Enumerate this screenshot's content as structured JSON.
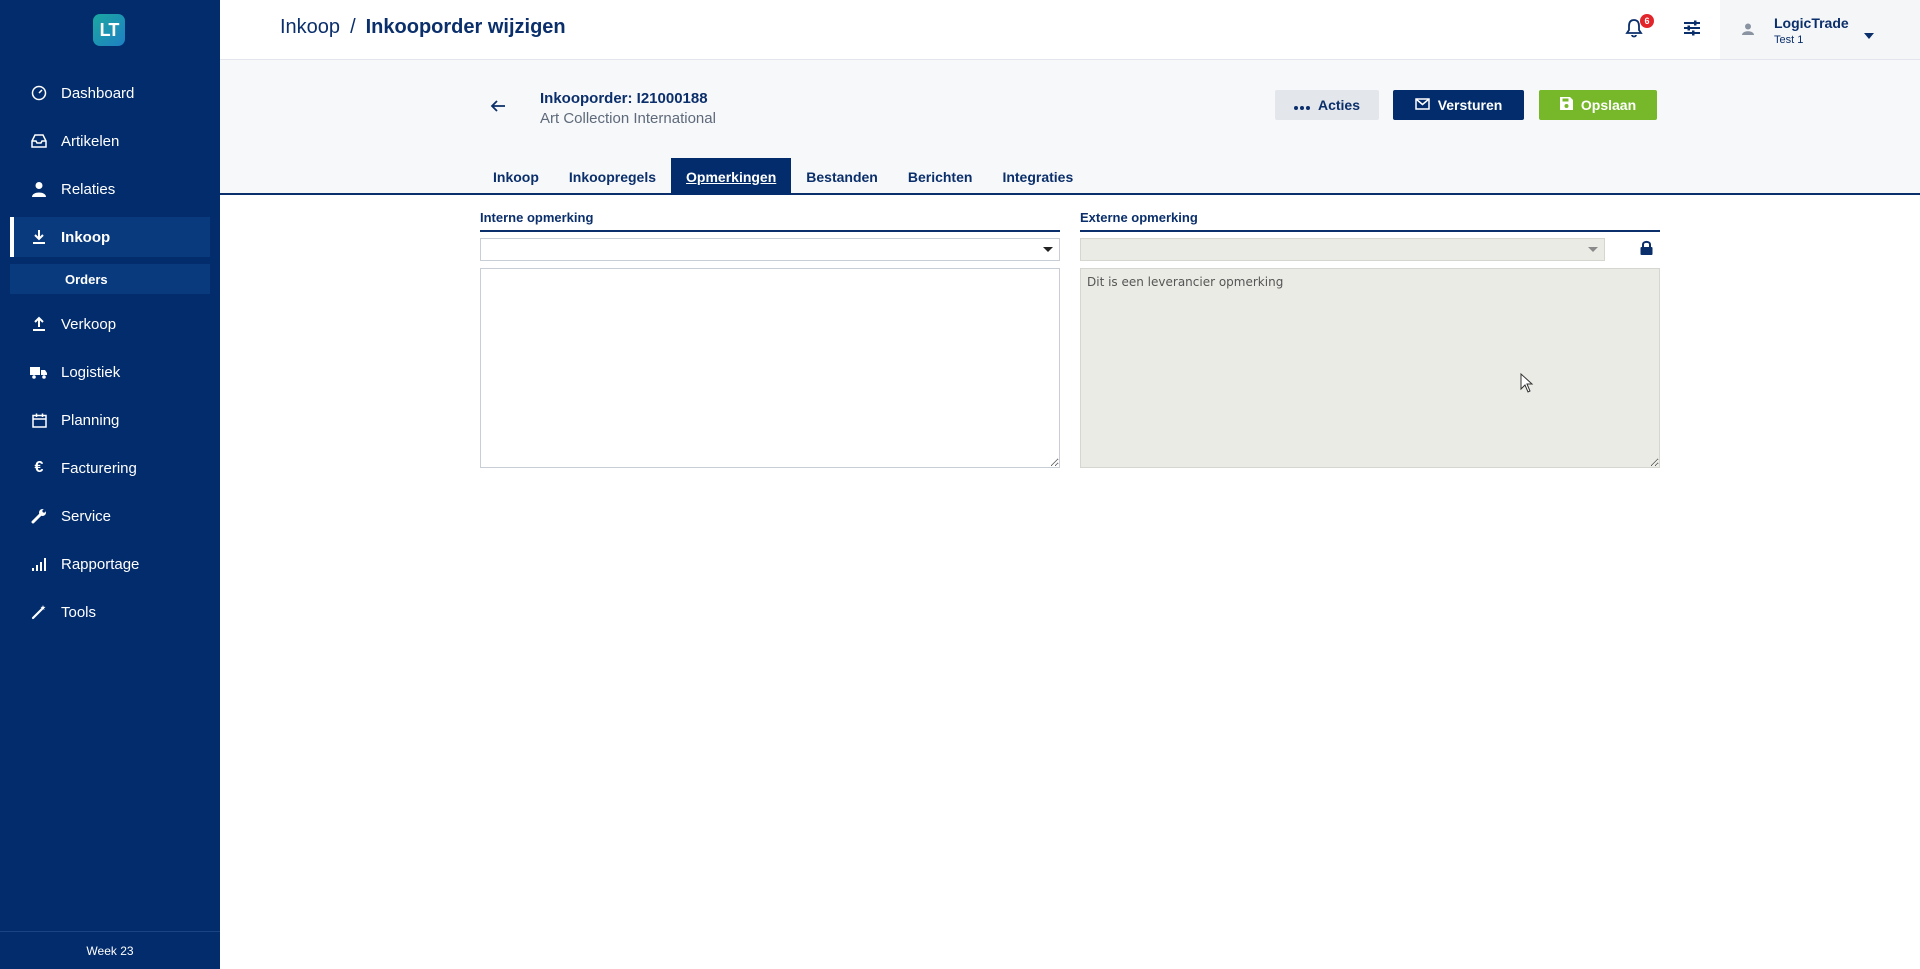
{
  "app": {
    "logo_text": "LT",
    "colors": {
      "brand_navy": "#022c6b",
      "save_green": "#76b82a",
      "badge_red": "#e2242b"
    }
  },
  "sidebar": {
    "items": [
      {
        "label": "Dashboard",
        "icon": "dashboard-gauge-icon"
      },
      {
        "label": "Artikelen",
        "icon": "inbox-tray-icon"
      },
      {
        "label": "Relaties",
        "icon": "person-icon"
      },
      {
        "label": "Inkoop",
        "icon": "download-icon",
        "active": true
      },
      {
        "label": "Verkoop",
        "icon": "upload-icon"
      },
      {
        "label": "Logistiek",
        "icon": "truck-icon"
      },
      {
        "label": "Planning",
        "icon": "calendar-icon"
      },
      {
        "label": "Facturering",
        "icon": "euro-icon"
      },
      {
        "label": "Service",
        "icon": "wrench-icon"
      },
      {
        "label": "Rapportage",
        "icon": "bar-signal-icon"
      },
      {
        "label": "Tools",
        "icon": "magic-wand-icon"
      }
    ],
    "sub_item": "Orders",
    "week": "Week 23"
  },
  "header": {
    "breadcrumb_parent": "Inkoop",
    "breadcrumb_sep": "/",
    "breadcrumb_current": "Inkooporder wijzigen",
    "notification_count": "6",
    "user_name": "LogicTrade",
    "user_sub": "Test 1"
  },
  "order": {
    "title": "Inkooporder: I21000188",
    "subtitle": "Art Collection International"
  },
  "actions": {
    "acties": "Acties",
    "versturen": "Versturen",
    "opslaan": "Opslaan"
  },
  "tabs": [
    {
      "label": "Inkoop"
    },
    {
      "label": "Inkoopregels"
    },
    {
      "label": "Opmerkingen",
      "active": true
    },
    {
      "label": "Bestanden"
    },
    {
      "label": "Berichten"
    },
    {
      "label": "Integraties"
    }
  ],
  "remarks": {
    "internal_label": "Interne opmerking",
    "internal_value": "",
    "external_label": "Externe opmerking",
    "external_value": "Dit is een leverancier opmerking"
  }
}
